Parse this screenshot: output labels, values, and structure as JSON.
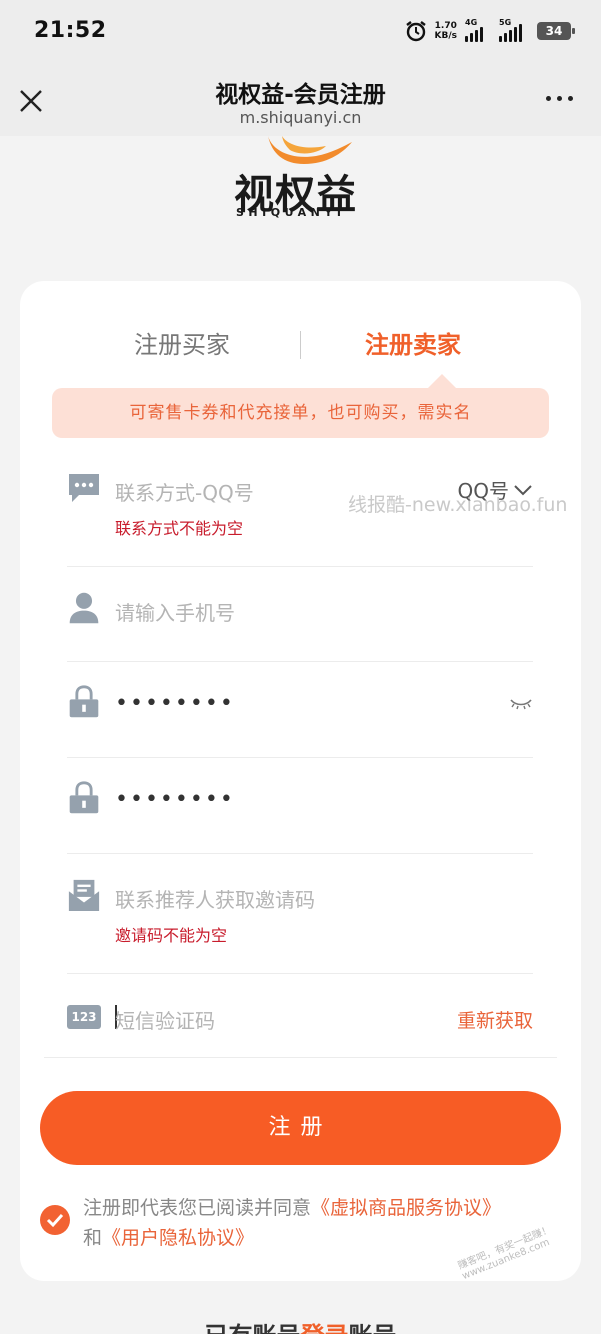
{
  "status_bar": {
    "time": "21:52",
    "speed_value": "1.70",
    "speed_unit": "KB/s",
    "net1": "4G",
    "net2": "5G",
    "battery": "34"
  },
  "nav": {
    "title": "视权益-会员注册",
    "url": "m.shiquanyi.cn"
  },
  "logo": {
    "text": "视权益",
    "subtitle": "SHIQUANYI"
  },
  "tabs": [
    {
      "label": "注册买家",
      "active": false
    },
    {
      "label": "注册卖家",
      "active": true
    }
  ],
  "notice": "可寄售卡券和代充接单，也可购买，需实名",
  "fields": {
    "contact": {
      "placeholder": "联系方式-QQ号",
      "select_value": "QQ号",
      "error": "联系方式不能为空"
    },
    "phone": {
      "placeholder": "请输入手机号"
    },
    "password": {
      "value": "••••••••"
    },
    "password_confirm": {
      "value": "••••••••"
    },
    "invite": {
      "placeholder": "联系推荐人获取邀请码",
      "error": "邀请码不能为空"
    },
    "sms": {
      "placeholder": "短信验证码",
      "resend_label": "重新获取",
      "icon_text": "123"
    }
  },
  "submit_label": "注册",
  "agreement": {
    "prefix": "注册即代表您已阅读并同意",
    "link1": "《虚拟商品服务协议》",
    "and": "和",
    "link2": "《用户隐私协议》"
  },
  "watermark": "线报酷-new.xianbao.fun",
  "watermark2": "赚客吧，有奖一起赚！ www.zuanke8.com",
  "footer": {
    "prefix": "已有账号",
    "link": "登录",
    "suffix": "账号"
  },
  "colors": {
    "accent": "#f75c25",
    "error": "#c81c2c",
    "notice_bg": "#fde0d6"
  }
}
